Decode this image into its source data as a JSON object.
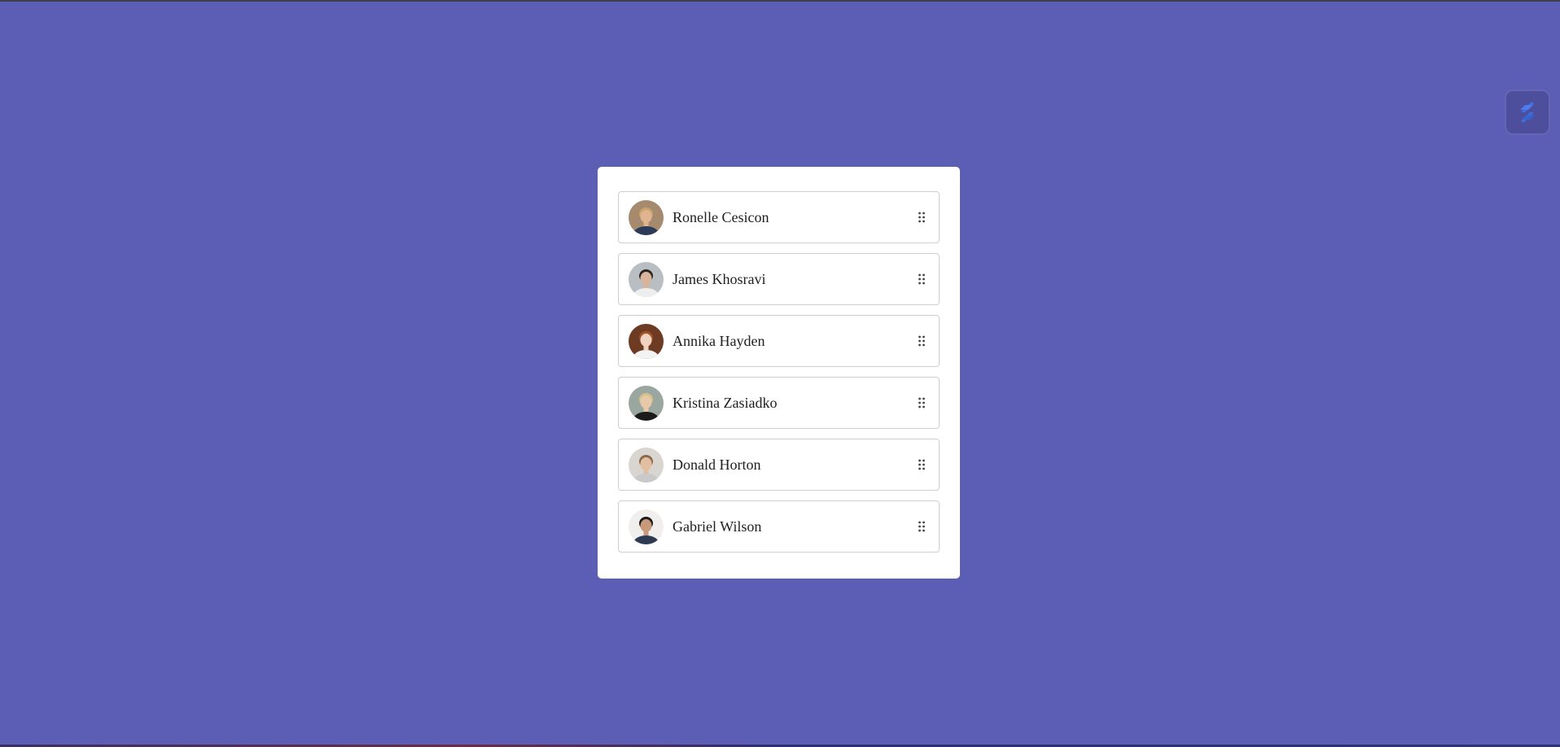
{
  "list": {
    "items": [
      {
        "name": "Ronelle Cesicon",
        "avatar_icon": "avatar-photo-icon",
        "bg": "#a58a6e",
        "skin": "#e0b48e",
        "hair": "#c9a46c",
        "shirt": "#2c3b5a"
      },
      {
        "name": "James Khosravi",
        "avatar_icon": "avatar-photo-icon",
        "bg": "#b9bec3",
        "skin": "#d8b49a",
        "hair": "#2a2422",
        "shirt": "#eeeeee"
      },
      {
        "name": "Annika Hayden",
        "avatar_icon": "avatar-photo-icon",
        "bg": "#6d3a22",
        "skin": "#f0d2c0",
        "hair": "#a2532c",
        "shirt": "#f3f3f3"
      },
      {
        "name": "Kristina Zasiadko",
        "avatar_icon": "avatar-photo-icon",
        "bg": "#9aa6a0",
        "skin": "#e6c9a8",
        "hair": "#d8c08a",
        "shirt": "#1b1b1b"
      },
      {
        "name": "Donald Horton",
        "avatar_icon": "avatar-photo-icon",
        "bg": "#d9d6d2",
        "skin": "#e3bea0",
        "hair": "#8a6a4a",
        "shirt": "#c9c9c9"
      },
      {
        "name": "Gabriel Wilson",
        "avatar_icon": "avatar-photo-icon",
        "bg": "#f1efee",
        "skin": "#c99a7a",
        "hair": "#1c1a19",
        "shirt": "#2d3a52"
      }
    ],
    "handle_icon": "drag-handle-icon"
  },
  "fab": {
    "icon": "stripe-logo-icon",
    "color": "#3d6fe0"
  },
  "colors": {
    "background": "#5b5eb4",
    "card": "#ffffff",
    "border": "#cfcfcf",
    "text": "#1e1e1e"
  }
}
